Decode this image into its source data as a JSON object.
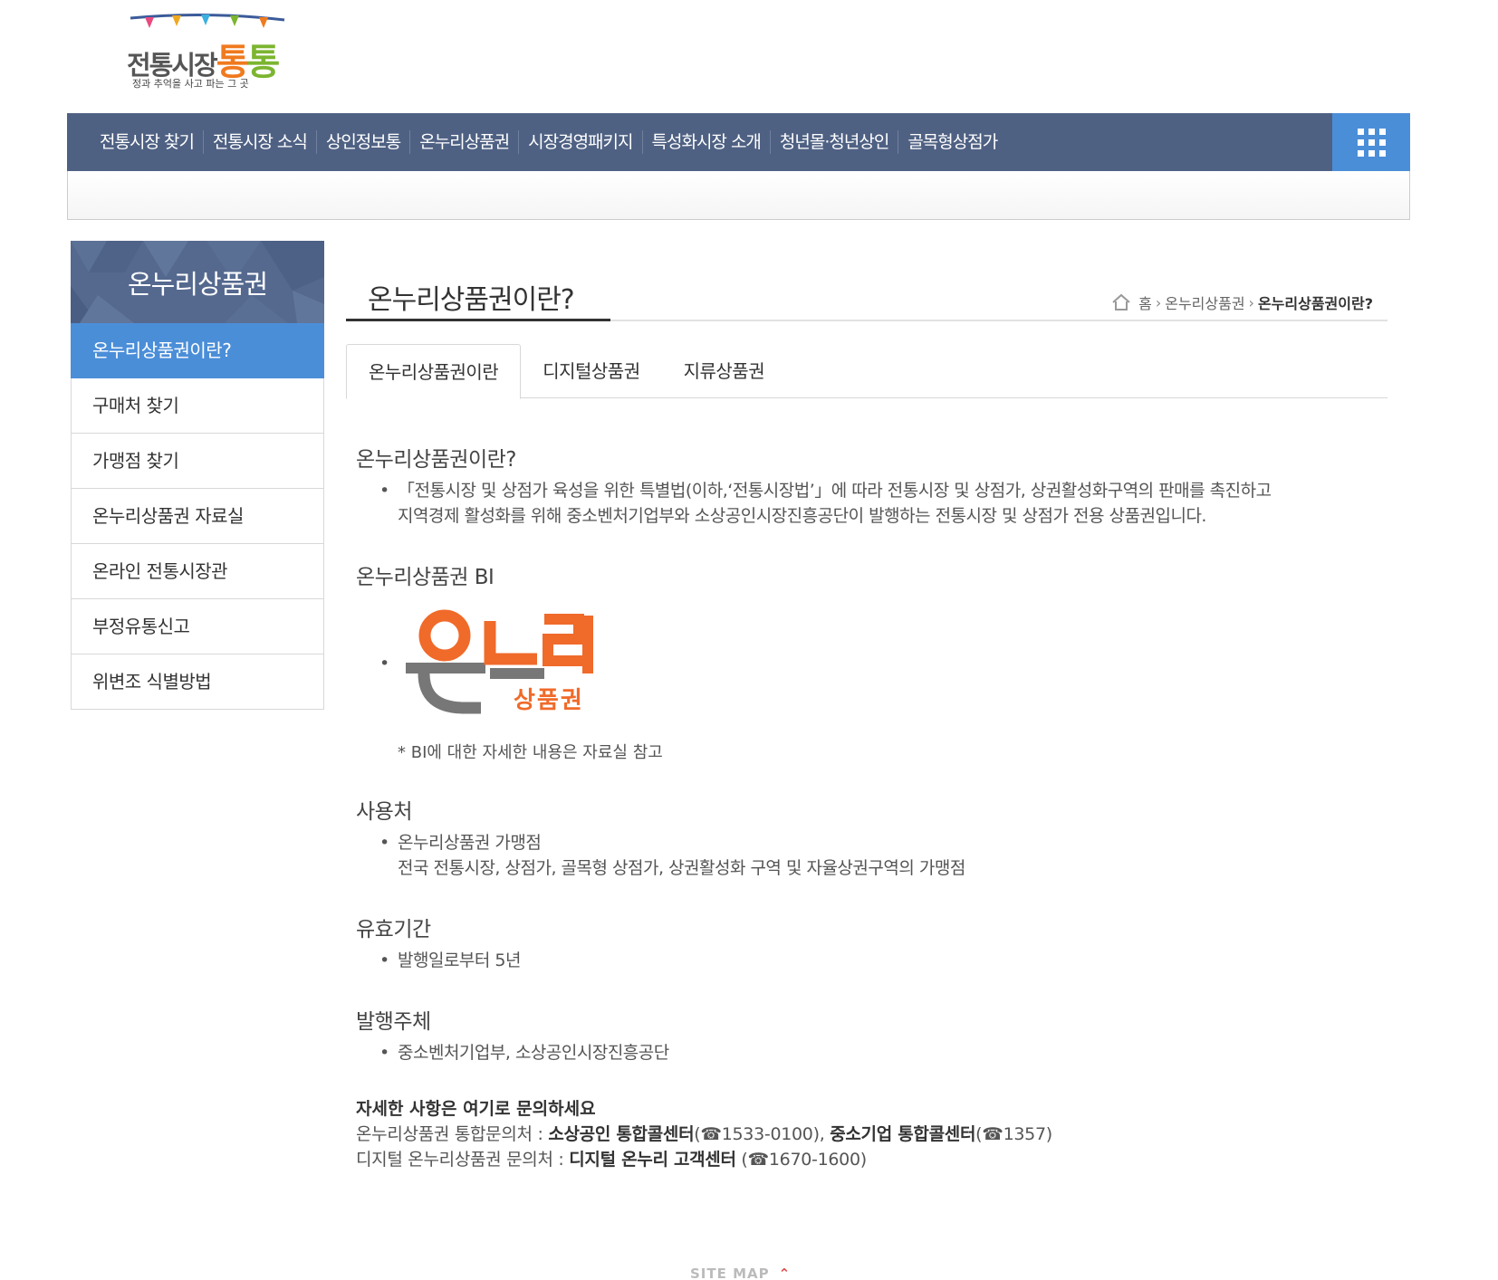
{
  "logo": {
    "main_text": "전통시장",
    "brand_part1": "통",
    "brand_part2": "통",
    "tagline": "정과 추억을 사고 파는 그 곳"
  },
  "gnb": {
    "items": [
      "전통시장 찾기",
      "전통시장 소식",
      "상인정보통",
      "온누리상품권",
      "시장경영패키지",
      "특성화시장 소개",
      "청년몰·청년상인",
      "골목형상점가"
    ],
    "all_menu_icon": "grid-icon"
  },
  "lnb": {
    "title": "온누리상품권",
    "items": [
      "온누리상품권이란?",
      "구매처 찾기",
      "가맹점 찾기",
      "온누리상품권 자료실",
      "온라인 전통시장관",
      "부정유통신고",
      "위변조 식별방법"
    ],
    "active_index": 0
  },
  "page": {
    "title": "온누리상품권이란?",
    "breadcrumb": {
      "home": "홈",
      "level1": "온누리상품권",
      "current": "온누리상품권이란?"
    }
  },
  "tabs": [
    "온누리상품권이란",
    "디지털상품권",
    "지류상품권"
  ],
  "content": {
    "sec1_title": "온누리상품권이란?",
    "sec1_line1": "「전통시장 및 상점가 육성을 위한 특별법(이하,‘전통시장법’」에 따라 전통시장 및 상점가, 상권활성화구역의 판매를 촉진하고",
    "sec1_line2": "지역경제 활성화를 위해 중소벤처기업부와 소상공인시장진흥공단이 발행하는 전통시장 및 상점가 전용 상품권입니다.",
    "sec2_title": "온누리상품권 BI",
    "bi_logo_text1": "온누리",
    "bi_logo_text2": "상품권",
    "bi_note": "* BI에 대한 자세한 내용은 자료실 참고",
    "sec3_title": "사용처",
    "sec3_line1": "온누리상품권 가맹점",
    "sec3_line2": "전국 전통시장, 상점가, 골목형 상점가, 상권활성화 구역 및 자율상권구역의 가맹점",
    "sec4_title": "유효기간",
    "sec4_line1": "발행일로부터 5년",
    "sec5_title": "발행주체",
    "sec5_line1": "중소벤처기업부, 소상공인시장진흥공단",
    "contact_title": "자세한 사항은 여기로 문의하세요",
    "contact1_label": "온누리상품권 통합문의처 : ",
    "contact1_org1": "소상공인 통합콜센터",
    "contact1_tel1": "(☎1533-0100), ",
    "contact1_org2": "중소기업 통합콜센터",
    "contact1_tel2": "(☎1357)",
    "contact2_label": "디지털 온누리상품권 문의처 : ",
    "contact2_org": "디지털 온누리 고객센터",
    "contact2_tel": " (☎1670-1600)"
  },
  "footer": {
    "sitemap": "SITE MAP",
    "sitemap_icon": "chevron-up-icon"
  }
}
